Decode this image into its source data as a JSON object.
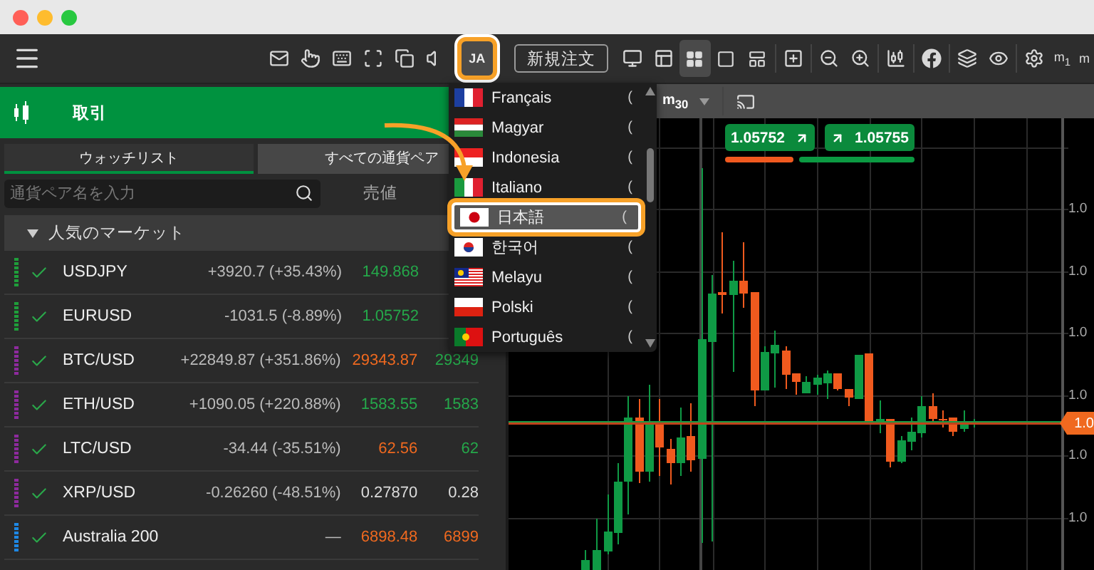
{
  "toolbar": {
    "language_button": {
      "label": "JA",
      "highlighted": true
    },
    "order_button": {
      "label": "新規注文"
    },
    "layout_buttons": [
      {
        "selected": true
      },
      {
        "selected": false
      },
      {
        "selected": false
      }
    ],
    "timeframes": [
      "m$_{1}$",
      "m"
    ]
  },
  "trade_header": {
    "title": "取引"
  },
  "watchlist": {
    "tabs": [
      {
        "label": "ウォッチリスト",
        "selected": true
      },
      {
        "label": "すべての通貨ペア",
        "selected": false
      }
    ],
    "search": {
      "placeholder": "通貨ペア名を入力"
    },
    "columns": [
      "売値"
    ],
    "section": {
      "title": "人気のマーケット",
      "expanded": true
    },
    "rows": [
      {
        "symbol": "USDJPY",
        "change": "+3920.7 (+35.43%)",
        "sell": {
          "text": "149.868",
          "color": "#25a84a"
        },
        "checked": true,
        "color": "#1f9e3a"
      },
      {
        "symbol": "EURUSD",
        "change": "-1031.5 (-8.89%)",
        "sell": {
          "text": "1.05752",
          "color": "#25a84a"
        },
        "checked": true,
        "color": "#1f9e3a"
      },
      {
        "symbol": "BTC/USD",
        "change": "+22849.87 (+351.86%)",
        "sell": {
          "text": "29343.87",
          "color": "#f0691f"
        },
        "buy": {
          "text": "29349",
          "color": "#25a84a"
        },
        "checked": true,
        "color": "#8e2a9e"
      },
      {
        "symbol": "ETH/USD",
        "change": "+1090.05 (+220.88%)",
        "sell": {
          "text": "1583.55",
          "color": "#25a84a"
        },
        "buy": {
          "text": "1583",
          "color": "#25a84a"
        },
        "checked": true,
        "color": "#8e2a9e"
      },
      {
        "symbol": "LTC/USD",
        "change": "-34.44 (-35.51%)",
        "sell": {
          "text": "62.56",
          "color": "#f0691f"
        },
        "buy": {
          "text": "62",
          "color": "#25a84a"
        },
        "checked": true,
        "color": "#8e2a9e"
      },
      {
        "symbol": "XRP/USD",
        "change": "-0.26260 (-48.51%)",
        "sell": {
          "text": "0.27870",
          "color": "#dcdcdc"
        },
        "buy": {
          "text": "0.28",
          "color": "#dcdcdc"
        },
        "checked": true,
        "color": "#8e2a9e"
      },
      {
        "symbol": "Australia 200",
        "change": "—",
        "sell": {
          "text": "6898.48",
          "color": "#f0691f"
        },
        "buy": {
          "text": "6899",
          "color": "#f0691f"
        },
        "checked": true,
        "color": "#1e88e5"
      }
    ]
  },
  "language_menu": {
    "items": [
      {
        "label": "Français",
        "kind": "fr",
        "note": "(",
        "selected": false,
        "highlighted": false
      },
      {
        "label": "Magyar",
        "kind": "hu",
        "note": "(",
        "selected": false,
        "highlighted": false
      },
      {
        "label": "Indonesia",
        "kind": "id",
        "note": "(",
        "selected": false,
        "highlighted": false
      },
      {
        "label": "Italiano",
        "kind": "it",
        "note": "(",
        "selected": false,
        "highlighted": false
      },
      {
        "label": "日本語",
        "kind": "jp",
        "note": "(",
        "selected": true,
        "highlighted": true
      },
      {
        "label": "한국어",
        "kind": "kr",
        "note": "(",
        "selected": false,
        "highlighted": false
      },
      {
        "label": "Melayu",
        "kind": "my",
        "note": "(",
        "selected": false,
        "highlighted": false
      },
      {
        "label": "Polski",
        "kind": "pl",
        "note": "(",
        "selected": false,
        "highlighted": false
      },
      {
        "label": "Português",
        "kind": "pt",
        "note": "(",
        "selected": false,
        "highlighted": false
      }
    ]
  },
  "chart": {
    "timeframe": "m$_{30}$",
    "sell_ticket": {
      "price": "1.05752"
    },
    "buy_ticket": {
      "price": "1.05755"
    },
    "axis_labels": [
      "1.0",
      "1.0",
      "1.0",
      "1.0",
      "1.0",
      "1.0"
    ],
    "price_tag": "1.0"
  }
}
